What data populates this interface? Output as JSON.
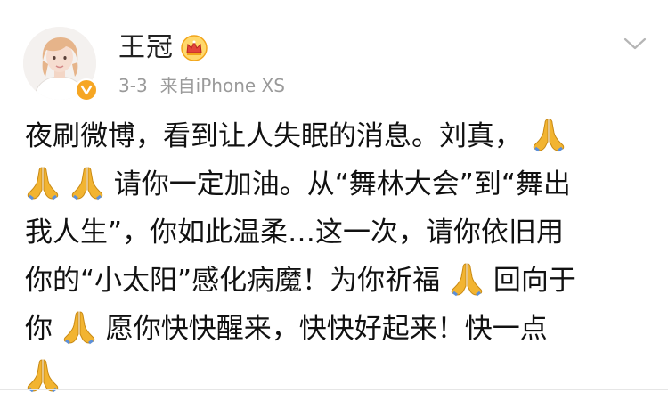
{
  "post": {
    "author": {
      "name": "王冠",
      "avatar_icon": "avatar-photo",
      "badge_icon": "verified-badge-icon",
      "crown_icon": "crown-icon"
    },
    "meta": {
      "date": "3-3",
      "source": "来自iPhone XS"
    },
    "menu_icon": "chevron-down-icon",
    "content_lines": [
      {
        "s1": "夜刷微博，看到让人失眠的消息。刘真，"
      },
      {
        "s1": "请你一定加油。从“舞林大会”到“舞出"
      },
      {
        "s1": "我人生”，你如此温柔…这一次，请你依旧用"
      },
      {
        "s1": "你的“小太阳”感化病魔！为你祈福",
        "s2": "回向于"
      },
      {
        "s1": "你",
        "s2": "愿你快快醒来，快快好起来！快一点"
      }
    ],
    "emoji": "folded-hands-icon",
    "colors": {
      "text": "#111111",
      "meta": "#9a9a9a",
      "badge": "#f6a623",
      "emoji": "#f2b431"
    }
  }
}
